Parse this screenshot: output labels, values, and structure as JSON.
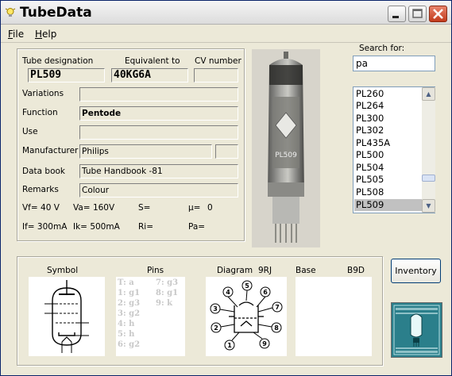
{
  "app": {
    "title": "TubeData"
  },
  "menu": {
    "file_rest": "ile",
    "file_u": "F",
    "help_rest": "elp",
    "help_u": "H"
  },
  "search": {
    "label": "Search for:",
    "value": "pa"
  },
  "list": {
    "items": [
      "PL260",
      "PL264",
      "PL300",
      "PL302",
      "PL435A",
      "PL500",
      "PL504",
      "PL505",
      "PL508",
      "PL509"
    ],
    "selected": "PL509"
  },
  "details": {
    "tube_designation_label": "Tube designation",
    "equivalent_label": "Equivalent to",
    "cv_label": "CV number",
    "tube_designation": "PL509",
    "equivalent": "40KG6A",
    "cv_number": "",
    "variations_label": "Variations",
    "variations": "",
    "function_label": "Function",
    "function": "Pentode",
    "use_label": "Use",
    "use": "",
    "manufacturer_label": "Manufacturer",
    "manufacturer": "Philips",
    "databook_label": "Data book",
    "databook": "Tube Handbook -81",
    "remarks_label": "Remarks",
    "remarks": "Colour",
    "vf": "Vf= 40 V",
    "va": "Va= 160V",
    "s": "S=",
    "mu_label": "µ=",
    "mu_value": "0",
    "if": "If= 300mA",
    "ik": "Ik=  500mA",
    "ri": "Ri=",
    "pa": "Pa="
  },
  "bottom": {
    "symbol_label": "Symbol",
    "pins_label": "Pins",
    "diagram_label": "Diagram",
    "diagram_code": "9RJ",
    "base_label": "Base",
    "base_code": "B9D",
    "pins_col1": [
      "T: a",
      "1: g1",
      "2: g3",
      "3: g2",
      "4: h",
      "5: h",
      "6: g2"
    ],
    "pins_col2": [
      "7: g3",
      "8: g1",
      "9: k"
    ],
    "diagram_pins": [
      "1",
      "2",
      "3",
      "4",
      "5",
      "6",
      "7",
      "8",
      "9"
    ]
  },
  "buttons": {
    "inventory": "Inventory"
  },
  "photo": {
    "tube_print": "PL509"
  }
}
